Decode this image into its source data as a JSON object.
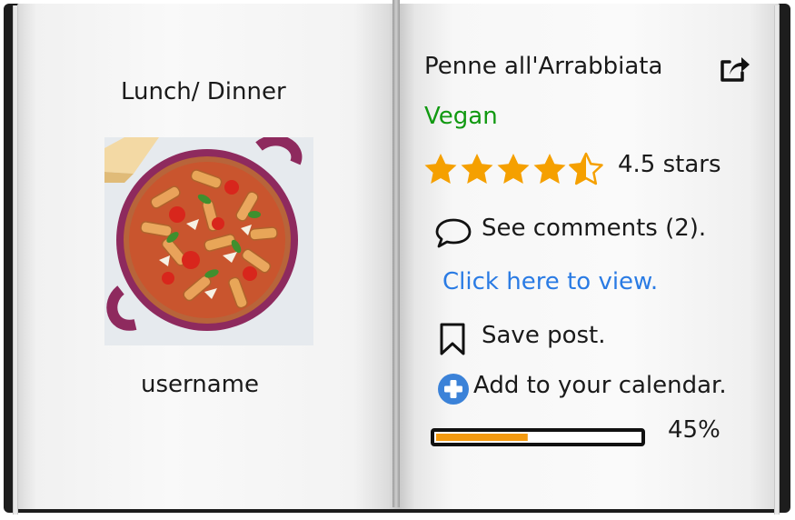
{
  "left_page": {
    "meal_type": "Lunch/ Dinner",
    "username": "username"
  },
  "right_page": {
    "recipe_title": "Penne all'Arrabbiata",
    "diet_tag": "Vegan",
    "rating_value": 4.5,
    "rating_max": 5,
    "rating_text": "4.5 stars",
    "comments_text": "See comments (2).",
    "view_link": "Click here to view.",
    "save_text": "Save post.",
    "calendar_text": "Add to your calendar.",
    "progress_value": 45,
    "progress_text": "45%"
  },
  "icons": {
    "share": "share-arrow-icon",
    "star": "star-icon",
    "comment": "speech-bubble-icon",
    "bookmark": "bookmark-icon",
    "add": "plus-circle-icon"
  },
  "colors": {
    "diet_tag": "#119911",
    "link": "#2a7be4",
    "star": "#f5a000",
    "add_icon": "#3b82d8",
    "progress_fill": "#f49a10"
  }
}
